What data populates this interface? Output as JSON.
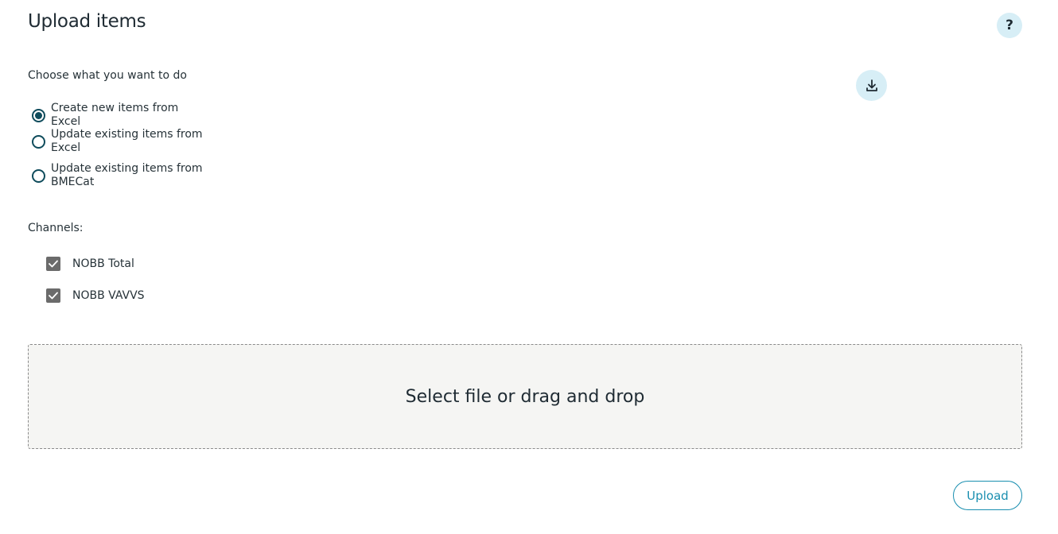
{
  "header": {
    "title": "Upload items",
    "help_label": "?"
  },
  "action": {
    "label": "Choose what you want to do",
    "options": [
      {
        "label": "Create new items from Excel",
        "selected": true
      },
      {
        "label": "Update existing items from Excel",
        "selected": false
      },
      {
        "label": "Update existing items from BMECat",
        "selected": false
      }
    ]
  },
  "channels": {
    "label": "Channels:",
    "items": [
      {
        "label": "NOBB Total",
        "checked": true
      },
      {
        "label": "NOBB VAVVS",
        "checked": true
      }
    ]
  },
  "dropzone": {
    "text": "Select file or drag and drop"
  },
  "footer": {
    "upload_label": "Upload"
  },
  "icons": {
    "help": "help-icon",
    "download": "download-icon",
    "check": "checkmark-icon"
  },
  "colors": {
    "accent": "#1a8fb0",
    "radio": "#0f4c5c",
    "icon_bg": "#d7eef6",
    "checkbox": "#6b6b6b",
    "dropzone_bg": "#f5f5f3"
  }
}
